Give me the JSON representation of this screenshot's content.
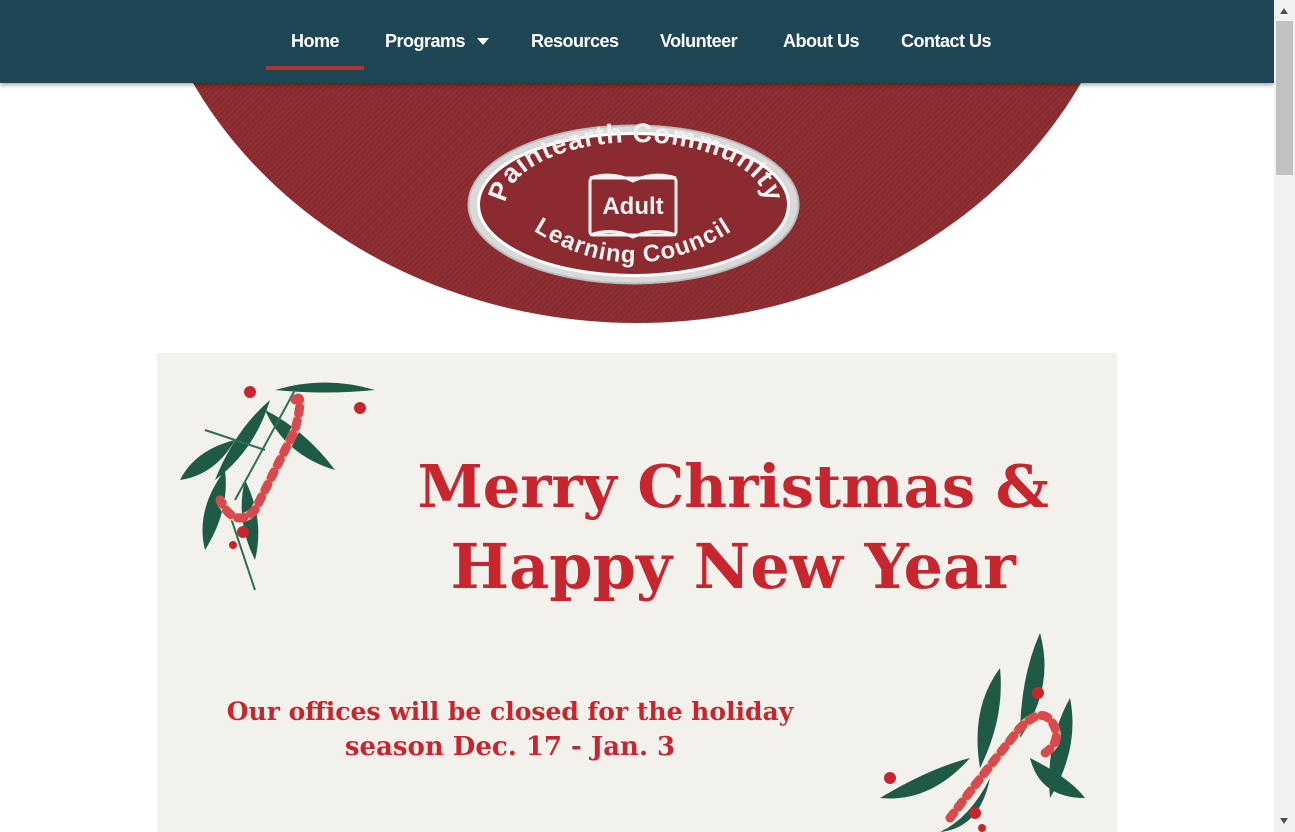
{
  "nav": {
    "items": [
      {
        "label": "Home",
        "active": true
      },
      {
        "label": "Programs",
        "has_dropdown": true
      },
      {
        "label": "Resources"
      },
      {
        "label": "Volunteer"
      },
      {
        "label": "About Us"
      },
      {
        "label": "Contact Us"
      }
    ]
  },
  "logo": {
    "top_text": "Paintearth Community",
    "center_text": "Adult",
    "bottom_text": "Learning Council"
  },
  "banner": {
    "line1": "Merry Christmas &",
    "line2": "Happy New Year",
    "notice_line1": "Our offices will be closed for the holiday",
    "notice_line2": "season Dec. 17 - Jan. 3"
  },
  "colors": {
    "nav_bg": "#1e4654",
    "hero_red": "#8b2b2f",
    "accent_red": "#c8262f",
    "banner_bg": "#f2f1ec"
  }
}
